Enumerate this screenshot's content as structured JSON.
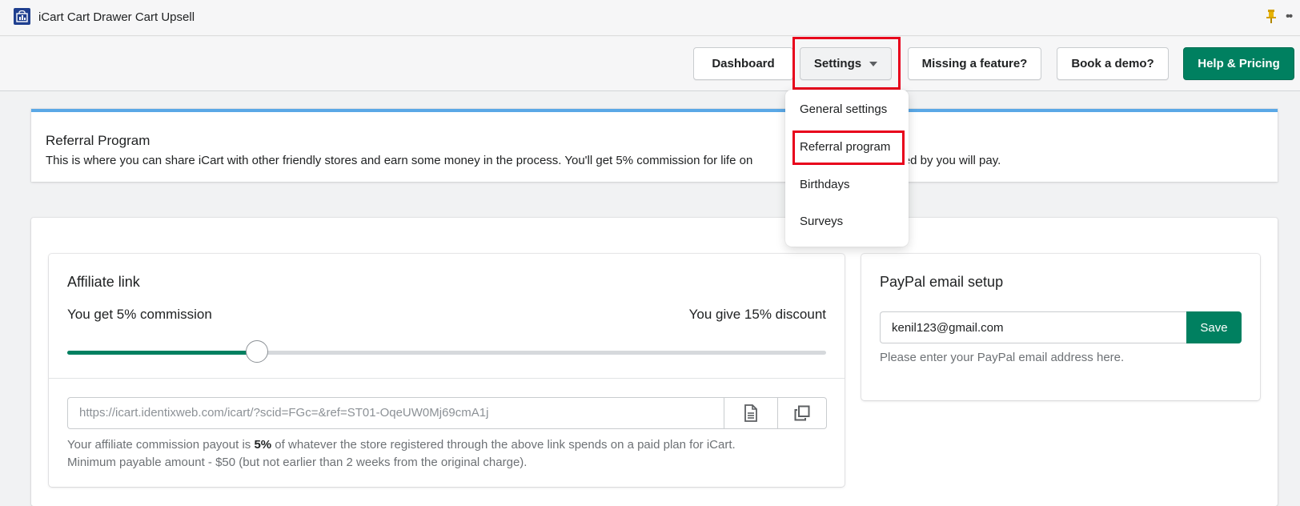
{
  "window": {
    "title": "iCart Cart Drawer Cart Upsell"
  },
  "toolbar": {
    "dashboard": "Dashboard",
    "settings": "Settings",
    "missing_feature": "Missing a feature?",
    "book_demo": "Book a demo?",
    "help_pricing": "Help & Pricing"
  },
  "settings_menu": {
    "items": [
      "General settings",
      "Referral program",
      "Birthdays",
      "Surveys"
    ]
  },
  "banner": {
    "title": "Referral Program",
    "description_left": "This is where you can share iCart with other friendly stores and earn some money in the process. You'll get 5% commission for life on",
    "description_right": "ferred by you will pay."
  },
  "affiliate": {
    "title": "Affiliate link",
    "you_get": "You get 5% commission",
    "you_give": "You give 15% discount",
    "slider_fraction": 0.25,
    "link": "https://icart.identixweb.com/icart/?scid=FGc=&ref=ST01-OqeUW0Mj69cmA1j",
    "help_pre": "Your affiliate commission payout is ",
    "help_bold": "5%",
    "help_post": " of whatever the store registered through the above link spends on a paid plan for iCart.",
    "help_line2": "Minimum payable amount - $50 (but not earlier than 2 weeks from the original charge)."
  },
  "paypal": {
    "title": "PayPal email setup",
    "email_value": "kenil123@gmail.com",
    "save": "Save",
    "help": "Please enter your PayPal email address here."
  },
  "colors": {
    "primary": "#008060",
    "highlight": "#e8001b",
    "banner_accent": "#5aa8e6"
  }
}
